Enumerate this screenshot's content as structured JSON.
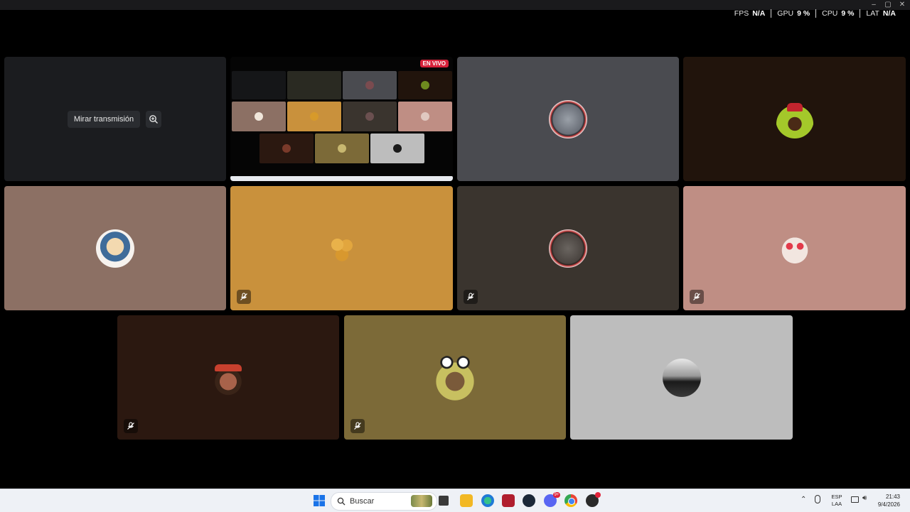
{
  "overlay": {
    "fps_label": "FPS",
    "fps_value": "N/A",
    "gpu_label": "GPU",
    "gpu_value": "9 %",
    "cpu_label": "CPU",
    "cpu_value": "9 %",
    "lat_label": "LAT",
    "lat_value": "N/A"
  },
  "stream": {
    "watch_label": "Mirar transmisión",
    "live_badge": "EN VIVO"
  },
  "tiles": [
    {
      "bg": "#4a4b50",
      "muted": false,
      "avatar": "mario-figure"
    },
    {
      "bg": "#21140c",
      "muted": false,
      "avatar": "avocado-character"
    },
    {
      "bg": "#8c7064",
      "muted": false,
      "avatar": "anime-girl"
    },
    {
      "bg": "#c9913c",
      "muted": true,
      "avatar": "round-buns"
    },
    {
      "bg": "#3a342e",
      "muted": true,
      "avatar": "mario-elephant"
    },
    {
      "bg": "#bf8e84",
      "muted": true,
      "avatar": "cat-glasses"
    },
    {
      "bg": "#2b1810",
      "muted": true,
      "avatar": "man-cap"
    },
    {
      "bg": "#7c6a38",
      "muted": true,
      "avatar": "frog-hat-boy"
    },
    {
      "bg": "#bdbdbd",
      "muted": false,
      "avatar": "bw-silhouette"
    }
  ],
  "taskbar": {
    "search_placeholder": "Buscar",
    "lang_top": "ESP",
    "lang_bottom": "LAA",
    "time": "21:43",
    "date": "9/4/2026",
    "discord_badge": "9+"
  },
  "colors": {
    "live": "#d6213a",
    "taskbar_bg": "#eef1f6"
  }
}
